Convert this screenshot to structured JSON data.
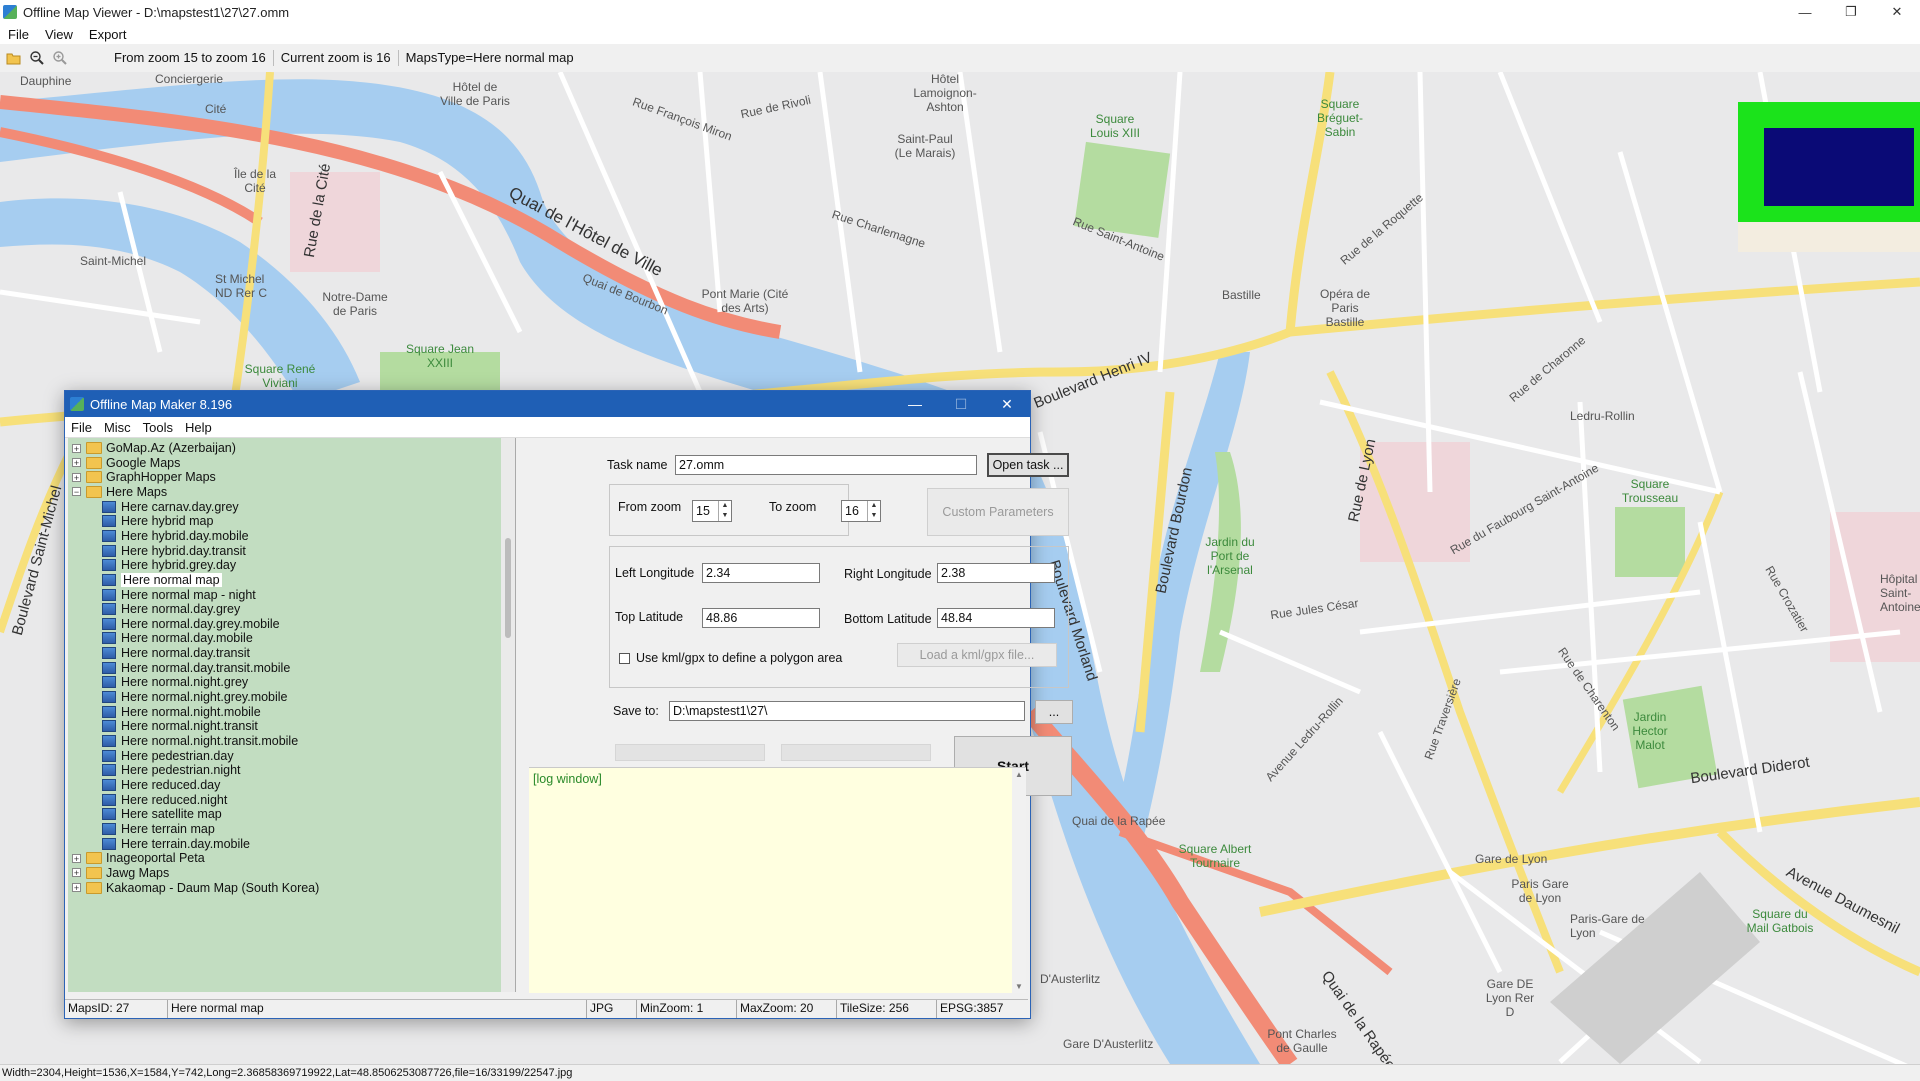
{
  "window": {
    "title": "Offline Map Viewer - D:\\mapstest1\\27\\27.omm",
    "controls": {
      "minimize": "—",
      "restore": "❐",
      "close": "✕"
    }
  },
  "menu": [
    "File",
    "View",
    "Export"
  ],
  "toolbar": {
    "icons": [
      "open-folder-icon",
      "zoom-out-icon",
      "zoom-in-icon"
    ],
    "zoom_range": "From zoom 15 to zoom 16",
    "current_zoom": "Current zoom is 16",
    "maps_type": "MapsType=Here normal map"
  },
  "map": {
    "labels": [
      "Dauphine",
      "Conciergerie",
      "Cité",
      "Hôtel de Ville de Paris",
      "Quai de l'Hôtel de Ville",
      "Rue de Rivoli",
      "Rue François Miron",
      "Hôtel Lamoignon-Ashton",
      "Saint-Paul (Le Marais)",
      "Square Louis XIII",
      "Square Bréguet-Sabin",
      "Île de la Cité",
      "Rue de la Cité",
      "Saint-Michel",
      "St Michel ND Rer C",
      "Notre-Dame de Paris",
      "Quai de Bourbon",
      "Pont Marie (Cité des Arts)",
      "Rue Charlemagne",
      "Rue Saint-Antoine",
      "Bastille",
      "Square Jean XXIII",
      "Square René Viviani",
      "Boulevard Henri IV",
      "Opéra de Paris Bastille",
      "Ledru-Rollin",
      "Square Trousseau",
      "Boulevard Bourdon",
      "Jardin du Port de l'Arsenal",
      "Rue de Lyon",
      "Boulevard Morland",
      "Rue Jules César",
      "Boulevard Saint-Michel",
      "Quai de la Rapée",
      "Square Albert Tournaire",
      "Avenue Ledru-Rollin",
      "Jardin Hector Malot",
      "Boulevard Diderot",
      "Gare de Lyon",
      "Paris Gare de Lyon",
      "Paris-Gare de Lyon",
      "Square du Mail Gatbois",
      "Avenue Daumesnil",
      "Gare DE Lyon Rer D",
      "D'Austerlitz",
      "Gare D'Austerlitz",
      "Pont Charles de Gaulle",
      "Quai de la Rapée",
      "Hôpital Saint-Antoine",
      "Rue de Charonne",
      "Rue de la Roquette",
      "Rue du Faubourg Saint-Antoine",
      "Rue Crozatier",
      "Rue de Charenton",
      "Rue Traversière"
    ],
    "overview_colors": {
      "frame": "#1be31b",
      "viewport": "#0a0a76",
      "background": "#f3ede0"
    }
  },
  "statusbar": "Width=2304,Height=1536,X=1584,Y=742,Long=2.36858369719922,Lat=48.8506253087726,file=16/33199/22547.jpg",
  "dialog": {
    "title": "Offline Map Maker 8.196",
    "controls": {
      "minimize": "—",
      "maximize": "☐",
      "close": "✕"
    },
    "menu": [
      "File",
      "Misc",
      "Tools",
      "Help"
    ],
    "tree": [
      {
        "label": "GoMap.Az (Azerbaijan)",
        "type": "folder",
        "expander": "+"
      },
      {
        "label": "Google Maps",
        "type": "folder",
        "expander": "+"
      },
      {
        "label": "GraphHopper Maps",
        "type": "folder",
        "expander": "+"
      },
      {
        "label": "Here Maps",
        "type": "folder-open",
        "expander": "−"
      },
      {
        "label": "Here carnav.day.grey",
        "type": "map"
      },
      {
        "label": "Here hybrid map",
        "type": "map"
      },
      {
        "label": "Here hybrid.day.mobile",
        "type": "map"
      },
      {
        "label": "Here hybrid.day.transit",
        "type": "map"
      },
      {
        "label": "Here hybrid.grey.day",
        "type": "map"
      },
      {
        "label": "Here normal map",
        "type": "map",
        "selected": true
      },
      {
        "label": "Here normal map - night",
        "type": "map"
      },
      {
        "label": "Here normal.day.grey",
        "type": "map"
      },
      {
        "label": "Here normal.day.grey.mobile",
        "type": "map"
      },
      {
        "label": "Here normal.day.mobile",
        "type": "map"
      },
      {
        "label": "Here normal.day.transit",
        "type": "map"
      },
      {
        "label": "Here normal.day.transit.mobile",
        "type": "map"
      },
      {
        "label": "Here normal.night.grey",
        "type": "map"
      },
      {
        "label": "Here normal.night.grey.mobile",
        "type": "map"
      },
      {
        "label": "Here normal.night.mobile",
        "type": "map"
      },
      {
        "label": "Here normal.night.transit",
        "type": "map"
      },
      {
        "label": "Here normal.night.transit.mobile",
        "type": "map"
      },
      {
        "label": "Here pedestrian.day",
        "type": "map"
      },
      {
        "label": "Here pedestrian.night",
        "type": "map"
      },
      {
        "label": "Here reduced.day",
        "type": "map"
      },
      {
        "label": "Here reduced.night",
        "type": "map"
      },
      {
        "label": "Here satellite map",
        "type": "map"
      },
      {
        "label": "Here terrain map",
        "type": "map"
      },
      {
        "label": "Here terrain.day.mobile",
        "type": "map"
      },
      {
        "label": "Inageoportal Peta",
        "type": "folder",
        "expander": "+"
      },
      {
        "label": "Jawg Maps",
        "type": "folder",
        "expander": "+"
      },
      {
        "label": "Kakaomap - Daum Map (South Korea)",
        "type": "folder",
        "expander": "+"
      }
    ],
    "form": {
      "task_name_label": "Task name",
      "task_name_value": "27.omm",
      "open_task_button": "Open task ...",
      "from_zoom_label": "From zoom",
      "from_zoom_value": "15",
      "to_zoom_label": "To zoom",
      "to_zoom_value": "16",
      "custom_parameters_button": "Custom Parameters",
      "left_longitude_label": "Left Longitude",
      "left_longitude_value": "2.34",
      "right_longitude_label": "Right Longitude",
      "right_longitude_value": "2.38",
      "top_latitude_label": "Top Latitude",
      "top_latitude_value": "48.86",
      "bottom_latitude_label": "Bottom Latitude",
      "bottom_latitude_value": "48.84",
      "kml_checkbox_label": "Use kml/gpx to define a polygon area",
      "load_kml_button": "Load a kml/gpx file...",
      "save_to_label": "Save to:",
      "save_to_value": "D:\\mapstest1\\27\\",
      "browse_button": "...",
      "start_button": "Start",
      "progress": [
        0,
        0,
        0
      ]
    },
    "log": "[log window]",
    "status": {
      "maps_id": "MapsID: 27",
      "map_name": "Here normal map",
      "format": "JPG",
      "min_zoom": "MinZoom: 1",
      "max_zoom": "MaxZoom: 20",
      "tile_size": "TileSize: 256",
      "epsg": "EPSG:3857"
    }
  }
}
